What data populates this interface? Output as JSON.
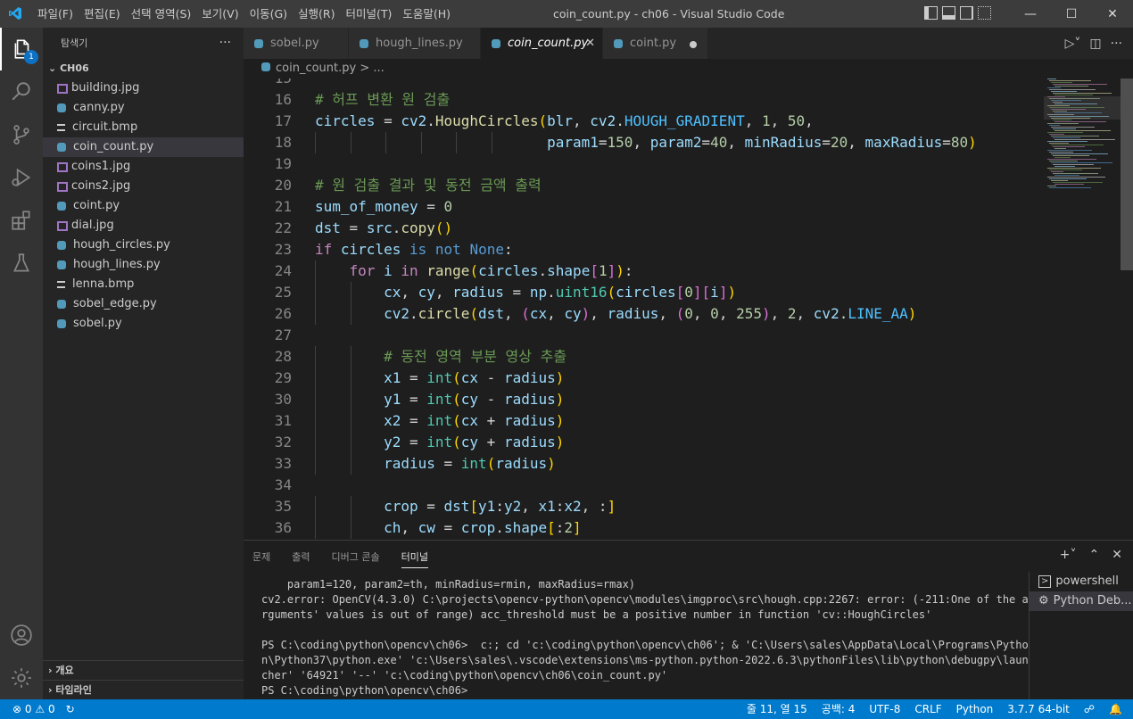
{
  "window": {
    "title": "coin_count.py - ch06 - Visual Studio Code"
  },
  "menu": [
    "파일(F)",
    "편집(E)",
    "선택 영역(S)",
    "보기(V)",
    "이동(G)",
    "실행(R)",
    "터미널(T)",
    "도움말(H)"
  ],
  "activity": {
    "badge": "1"
  },
  "sidebar": {
    "title": "탐색기",
    "more": "···",
    "folder": "CH06",
    "files": [
      {
        "name": "building.jpg",
        "icon": "image-file-icon",
        "color": "#a074c4"
      },
      {
        "name": "canny.py",
        "icon": "python-file-icon",
        "color": "#519aba"
      },
      {
        "name": "circuit.bmp",
        "icon": "bmp-file-icon",
        "color": "#cccccc"
      },
      {
        "name": "coin_count.py",
        "icon": "python-file-icon",
        "color": "#519aba",
        "selected": true
      },
      {
        "name": "coins1.jpg",
        "icon": "image-file-icon",
        "color": "#a074c4"
      },
      {
        "name": "coins2.jpg",
        "icon": "image-file-icon",
        "color": "#a074c4"
      },
      {
        "name": "coint.py",
        "icon": "python-file-icon",
        "color": "#519aba"
      },
      {
        "name": "dial.jpg",
        "icon": "image-file-icon",
        "color": "#a074c4"
      },
      {
        "name": "hough_circles.py",
        "icon": "python-file-icon",
        "color": "#519aba"
      },
      {
        "name": "hough_lines.py",
        "icon": "python-file-icon",
        "color": "#519aba"
      },
      {
        "name": "lenna.bmp",
        "icon": "bmp-file-icon",
        "color": "#cccccc"
      },
      {
        "name": "sobel_edge.py",
        "icon": "python-file-icon",
        "color": "#519aba"
      },
      {
        "name": "sobel.py",
        "icon": "python-file-icon",
        "color": "#519aba"
      }
    ],
    "outline": "개요",
    "timeline": "타임라인"
  },
  "tabs": [
    {
      "label": "sobel.py",
      "active": false
    },
    {
      "label": "hough_lines.py",
      "active": false
    },
    {
      "label": "coin_count.py",
      "active": true,
      "close": "✕"
    },
    {
      "label": "coint.py",
      "active": false,
      "dirty": true
    }
  ],
  "breadcrumb": {
    "file": "coin_count.py",
    "rest": " > ..."
  },
  "editor": {
    "lines": [
      {
        "n": "15",
        "t": ""
      },
      {
        "n": "16",
        "t": "cm:# 허프 변환 원 검출"
      },
      {
        "n": "17",
        "t": "vr:circles| = |vr:cv2|.|fn:HoughCircles|p1:(|vr:blr|, |vr:cv2|.|cn:HOUGH_GRADIENT|, |nm:1|, |nm:50|,"
      },
      {
        "n": "18",
        "t": "                           |vr:param1|=|nm:150|, |vr:param2|=|nm:40|, |vr:minRadius|=|nm:20|, |vr:maxRadius|=|nm:80|p1:)"
      },
      {
        "n": "19",
        "t": ""
      },
      {
        "n": "20",
        "t": "cm:# 원 검출 결과 및 동전 금액 출력"
      },
      {
        "n": "21",
        "t": "vr:sum_of_money| = |nm:0"
      },
      {
        "n": "22",
        "t": "vr:dst| = |vr:src|.|fn:copy|p1:()"
      },
      {
        "n": "23",
        "t": "kw:if| |vr:circles| |bl:is| |bl:not| |bl:None|:"
      },
      {
        "n": "24",
        "t": "    |kw:for| |vr:i| |kw:in| |fn:range|p1:(|vr:circles|.|vr:shape|p2:[|nm:1|p2:]|p1:)|:"
      },
      {
        "n": "25",
        "t": "        |vr:cx|, |vr:cy|, |vr:radius| = |vr:np|.|cl:uint16|p1:(|vr:circles|p2:[|nm:0|p2:]|p2:[|vr:i|p2:]|p1:)"
      },
      {
        "n": "26",
        "t": "        |vr:cv2|.|fn:circle|p1:(|vr:dst|, |p2:(|vr:cx|, |vr:cy|p2:)|, |vr:radius|, |p2:(|nm:0|, |nm:0|, |nm:255|p2:)|, |nm:2|, |vr:cv2|.|cn:LINE_AA|p1:)"
      },
      {
        "n": "27",
        "t": ""
      },
      {
        "n": "28",
        "t": "        |cm:# 동전 영역 부분 영상 추출"
      },
      {
        "n": "29",
        "t": "        |vr:x1| = |cl:int|p1:(|vr:cx| - |vr:radius|p1:)"
      },
      {
        "n": "30",
        "t": "        |vr:y1| = |cl:int|p1:(|vr:cy| - |vr:radius|p1:)"
      },
      {
        "n": "31",
        "t": "        |vr:x2| = |cl:int|p1:(|vr:cx| + |vr:radius|p1:)"
      },
      {
        "n": "32",
        "t": "        |vr:y2| = |cl:int|p1:(|vr:cy| + |vr:radius|p1:)"
      },
      {
        "n": "33",
        "t": "        |vr:radius| = |cl:int|p1:(|vr:radius|p1:)"
      },
      {
        "n": "34",
        "t": ""
      },
      {
        "n": "35",
        "t": "        |vr:crop| = |vr:dst|p1:[|vr:y1|:|vr:y2|, |vr:x1|:|vr:x2|, :|p1:]"
      },
      {
        "n": "36",
        "t": "        |vr:ch|, |vr:cw| = |vr:crop|.|vr:shape|p1:[|:|nm:2|p1:]"
      }
    ]
  },
  "panel": {
    "tabs": [
      "문제",
      "출력",
      "디버그 콘솔",
      "터미널"
    ],
    "active_tab": "터미널",
    "terminal": [
      "    param1=120, param2=th, minRadius=rmin, maxRadius=rmax)",
      "cv2.error: OpenCV(4.3.0) C:\\projects\\opencv-python\\opencv\\modules\\imgproc\\src\\hough.cpp:2267: error: (-211:One of the a",
      "rguments' values is out of range) acc_threshold must be a positive number in function 'cv::HoughCircles'",
      "",
      "PS C:\\coding\\python\\opencv\\ch06>  c:; cd 'c:\\coding\\python\\opencv\\ch06'; & 'C:\\Users\\sales\\AppData\\Local\\Programs\\Pytho",
      "n\\Python37\\python.exe' 'c:\\Users\\sales\\.vscode\\extensions\\ms-python.python-2022.6.3\\pythonFiles\\lib\\python\\debugpy\\laun",
      "cher' '64921' '--' 'c:\\coding\\python\\opencv\\ch06\\coin_count.py'",
      "PS C:\\coding\\python\\opencv\\ch06>"
    ],
    "terminals": [
      {
        "name": "powershell",
        "selected": false
      },
      {
        "name": "Python Deb...",
        "selected": true
      }
    ]
  },
  "status": {
    "errors": "0",
    "warnings": "0",
    "position": "줄 11, 열 15",
    "spaces": "공백: 4",
    "encoding": "UTF-8",
    "eol": "CRLF",
    "language": "Python",
    "interpreter": "3.7.7 64-bit"
  }
}
